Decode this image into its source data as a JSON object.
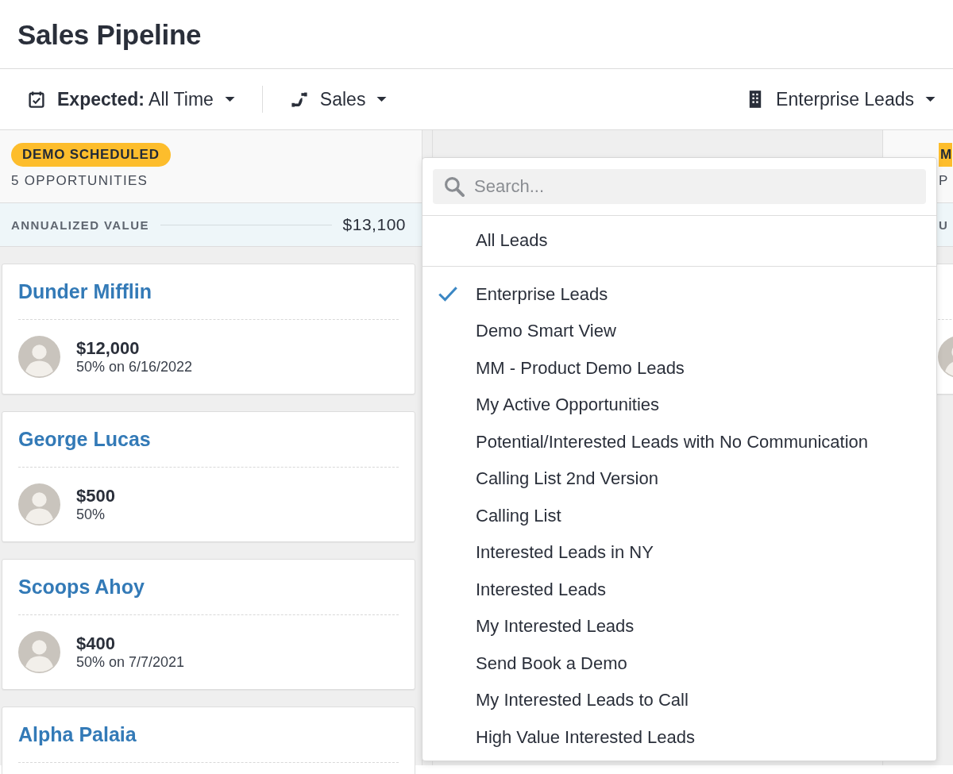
{
  "page": {
    "title": "Sales Pipeline"
  },
  "toolbar": {
    "date_filter": "**Expected:** All Time",
    "pipeline_filter": "Sales",
    "view_filter": "Enterprise Leads"
  },
  "columns": [
    {
      "badge": "DEMO SCHEDULED",
      "count": "5 OPPORTUNITIES",
      "value_label": "ANNUALIZED VALUE",
      "value": "$13,100",
      "cards": [
        {
          "title": "Dunder Mifflin",
          "amount": "$12,000",
          "detail": "50% on 6/16/2022"
        },
        {
          "title": "George Lucas",
          "amount": "$500",
          "detail": "50%"
        },
        {
          "title": "Scoops Ahoy",
          "amount": "$400",
          "detail": "50% on 7/7/2021"
        },
        {
          "title": "Alpha Palaia"
        }
      ]
    },
    {
      "badge": "M",
      "count": "P",
      "value_label": "U"
    }
  ],
  "dropdown": {
    "search": {
      "placeholder": "Search..."
    },
    "top_items": [
      {
        "label": "All Leads",
        "selected": false
      }
    ],
    "items": [
      {
        "label": "Enterprise Leads",
        "selected": true
      },
      {
        "label": "Demo Smart View",
        "selected": false
      },
      {
        "label": "MM - Product Demo Leads",
        "selected": false
      },
      {
        "label": "My Active Opportunities",
        "selected": false
      },
      {
        "label": "Potential/Interested Leads with No Communication",
        "selected": false
      },
      {
        "label": "Calling List 2nd Version",
        "selected": false
      },
      {
        "label": "Calling List",
        "selected": false
      },
      {
        "label": "Interested Leads in NY",
        "selected": false
      },
      {
        "label": "Interested Leads",
        "selected": false
      },
      {
        "label": "My Interested Leads",
        "selected": false
      },
      {
        "label": "Send Book a Demo",
        "selected": false
      },
      {
        "label": "My Interested Leads to Call",
        "selected": false
      },
      {
        "label": "High Value Interested Leads",
        "selected": false
      }
    ]
  }
}
